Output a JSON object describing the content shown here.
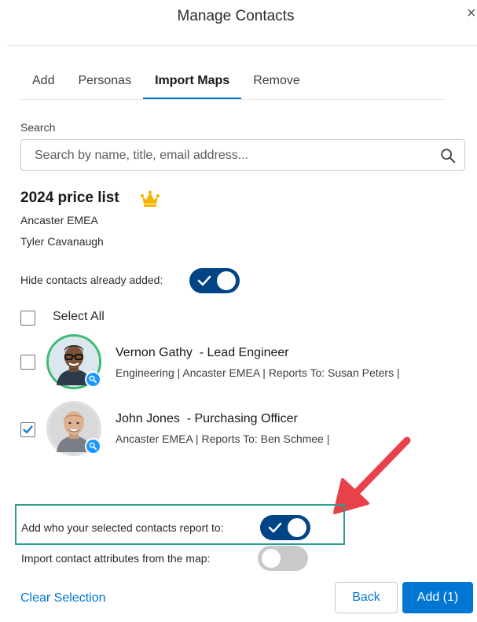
{
  "modal": {
    "title": "Manage Contacts",
    "close_glyph": "×"
  },
  "tabs": [
    {
      "label": "Add",
      "active": false
    },
    {
      "label": "Personas",
      "active": false
    },
    {
      "label": "Import Maps",
      "active": true
    },
    {
      "label": "Remove",
      "active": false
    }
  ],
  "search": {
    "label": "Search",
    "placeholder": "Search by name, title, email address...",
    "value": ""
  },
  "map": {
    "title": "2024 price list",
    "account": "Ancaster EMEA",
    "owner": "Tyler Cavanaugh",
    "icon": "crown-icon"
  },
  "hide_contacts": {
    "label": "Hide contacts already added:",
    "on": true
  },
  "select_all": {
    "label": "Select All",
    "checked": false
  },
  "contacts": [
    {
      "name": "Vernon Gathy",
      "title": "  - Lead Engineer",
      "details": "Engineering | Ancaster EMEA | Reports To: Susan Peters |",
      "checked": false
    },
    {
      "name": "John Jones",
      "title": "  - Purchasing Officer",
      "details": "Ancaster EMEA | Reports To: Ben Schmee |",
      "checked": true
    }
  ],
  "options": {
    "add_reports_to": {
      "label": "Add who your selected contacts report to:",
      "on": true
    },
    "import_attributes": {
      "label": "Import contact attributes from the map:",
      "on": false
    }
  },
  "footer": {
    "clear_label": "Clear Selection",
    "back_label": "Back",
    "add_label": "Add (1)"
  },
  "colors": {
    "brand": "#0176d3",
    "toggle_on": "#014486",
    "highlight": "#2a9d8f",
    "arrow": "#e8414a",
    "crown": "#f4b400"
  }
}
